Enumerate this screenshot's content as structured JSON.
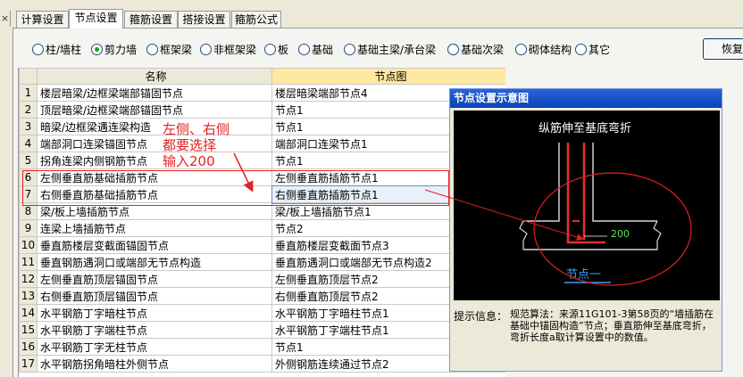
{
  "tabs": [
    {
      "label": "计算设置"
    },
    {
      "label": "节点设置"
    },
    {
      "label": "箍筋设置"
    },
    {
      "label": "搭接设置"
    },
    {
      "label": "箍筋公式"
    }
  ],
  "close_glyph": "×",
  "radios": [
    {
      "label": "柱/墙柱",
      "checked": false
    },
    {
      "label": "剪力墙",
      "checked": true
    },
    {
      "label": "框架梁",
      "checked": false
    },
    {
      "label": "非框架梁",
      "checked": false
    },
    {
      "label": "板",
      "checked": false
    },
    {
      "label": "基础",
      "checked": false
    },
    {
      "label": "基础主梁/承台梁",
      "checked": false
    },
    {
      "label": "基础次梁",
      "checked": false
    },
    {
      "label": "砌体结构",
      "checked": false
    },
    {
      "label": "其它",
      "checked": false
    }
  ],
  "restore_label": "恢复",
  "table": {
    "headers": {
      "name": "名称",
      "node": "节点图"
    },
    "rows": [
      {
        "idx": "1",
        "name": "楼层暗梁/边框梁端部锚固节点",
        "node": "楼层暗梁端部节点4"
      },
      {
        "idx": "2",
        "name": "顶层暗梁/边框梁端部锚固节点",
        "node": "节点1"
      },
      {
        "idx": "3",
        "name": "暗梁/边框梁遇连梁构造",
        "node": "节点1"
      },
      {
        "idx": "4",
        "name": "端部洞口连梁锚固节点",
        "node": "端部洞口连梁节点1"
      },
      {
        "idx": "5",
        "name": "拐角连梁内侧钢筋节点",
        "node": "节点1"
      },
      {
        "idx": "6",
        "name": "左侧垂直筋基础插筋节点",
        "node": "左侧垂直筋插筋节点1"
      },
      {
        "idx": "7",
        "name": "右侧垂直筋基础插筋节点",
        "node": "右侧垂直筋插筋节点1"
      },
      {
        "idx": "8",
        "name": "梁/板上墙插筋节点",
        "node": "梁/板上墙插筋节点1"
      },
      {
        "idx": "9",
        "name": "连梁上墙插筋节点",
        "node": "节点2"
      },
      {
        "idx": "10",
        "name": "垂直筋楼层变截面锚固节点",
        "node": "垂直筋楼层变截面节点3"
      },
      {
        "idx": "11",
        "name": "垂直钢筋遇洞口或端部无节点构造",
        "node": "垂直筋遇洞口或端部无节点构造2"
      },
      {
        "idx": "12",
        "name": "左侧垂直筋顶层锚固节点",
        "node": "左侧垂直筋顶层节点2"
      },
      {
        "idx": "13",
        "name": "右侧垂直筋顶层锚固节点",
        "node": "右侧垂直筋顶层节点2"
      },
      {
        "idx": "14",
        "name": "水平钢筋丁字暗柱节点",
        "node": "水平钢筋丁字暗柱节点1"
      },
      {
        "idx": "15",
        "name": "水平钢筋丁字端柱节点",
        "node": "水平钢筋丁字端柱节点1"
      },
      {
        "idx": "16",
        "name": "水平钢筋丁字无柱节点",
        "node": "节点1"
      },
      {
        "idx": "17",
        "name": "水平钢筋拐角暗柱外侧节点",
        "node": "外侧钢筋连续通过节点2"
      }
    ]
  },
  "annotation": {
    "lines": [
      "左侧、右侧",
      "都要选择",
      "输入200"
    ]
  },
  "panel": {
    "title": "节点设置示意图",
    "diagram": {
      "caption": "纵筋伸至基底弯折",
      "dimension": "200",
      "node_label": "节点一"
    },
    "hint_label": "提示信息：",
    "hint_text": "规范算法：来源11G101-3第58页的“墙插筋在基础中锚固构造”节点；垂直筋伸至基底弯折，弯折长度a取计算设置中的数值。"
  },
  "colors": {
    "annotation": "#E52020",
    "diagram_rebar": "#E53030",
    "diagram_bg": "#000000",
    "panel_title": "#0A42B8"
  }
}
